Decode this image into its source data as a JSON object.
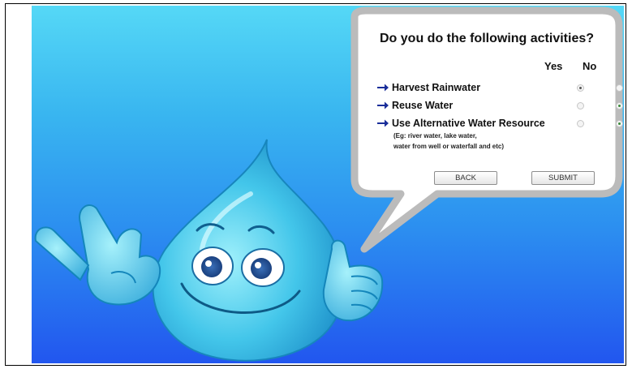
{
  "question": {
    "title": "Do you do the following activities?",
    "columns": {
      "yes": "Yes",
      "no": "No"
    },
    "items": [
      {
        "label": "Harvest Rainwater",
        "answer": "yes"
      },
      {
        "label": "Reuse Water",
        "answer": "no"
      },
      {
        "label": "Use Alternative Water Resource",
        "answer": "no",
        "note_lines": [
          "(Eg: river water, lake water,",
          "water from well or waterfall and etc)"
        ]
      }
    ]
  },
  "buttons": {
    "back": "BACK",
    "submit": "SUBMIT"
  },
  "colors": {
    "sky_top": "#55d8f6",
    "sky_bottom": "#2256ef",
    "bubble_fill": "#ffffff",
    "bubble_border": "#b9b9b9",
    "arrow": "#1a2e9a",
    "mascot": "#45c9ee"
  },
  "icons": [
    "arrow-right-icon",
    "water-drop-mascot",
    "peace-hand-icon",
    "thumbs-up-icon"
  ]
}
